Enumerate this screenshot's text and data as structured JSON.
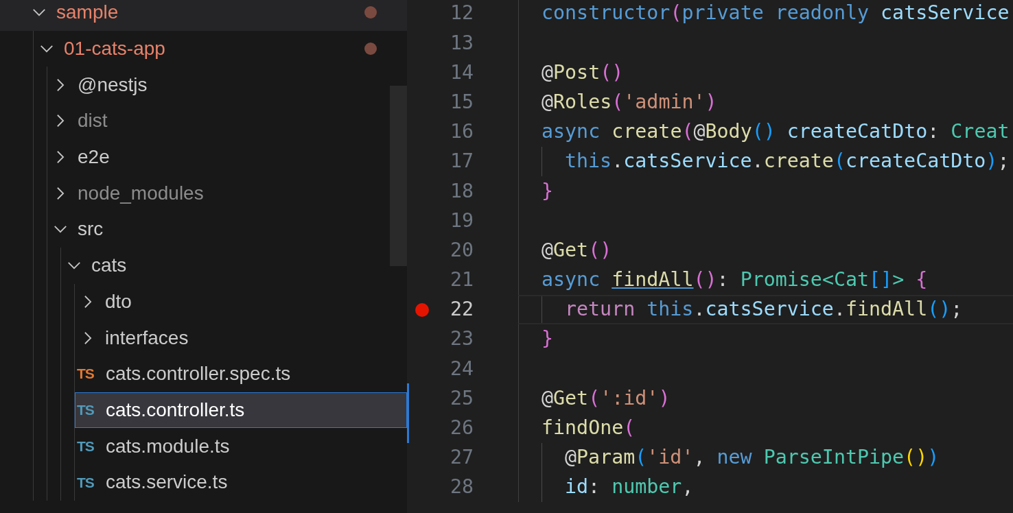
{
  "explorer": {
    "tree": [
      {
        "name": "sample",
        "kind": "folder",
        "expanded": true,
        "modified": true,
        "ignored": false,
        "selected": false,
        "children": [
          {
            "name": "01-cats-app",
            "kind": "folder",
            "expanded": true,
            "modified": true,
            "ignored": false,
            "selected": false,
            "children": [
              {
                "name": "@nestjs",
                "kind": "folder",
                "expanded": false,
                "modified": false,
                "ignored": false,
                "selected": false
              },
              {
                "name": "dist",
                "kind": "folder",
                "expanded": false,
                "modified": false,
                "ignored": true,
                "selected": false
              },
              {
                "name": "e2e",
                "kind": "folder",
                "expanded": false,
                "modified": false,
                "ignored": false,
                "selected": false
              },
              {
                "name": "node_modules",
                "kind": "folder",
                "expanded": false,
                "modified": false,
                "ignored": true,
                "selected": false
              },
              {
                "name": "src",
                "kind": "folder",
                "expanded": true,
                "modified": false,
                "ignored": false,
                "selected": false,
                "children": [
                  {
                    "name": "cats",
                    "kind": "folder",
                    "expanded": true,
                    "modified": false,
                    "ignored": false,
                    "selected": false,
                    "children": [
                      {
                        "name": "dto",
                        "kind": "folder",
                        "expanded": false,
                        "modified": false,
                        "ignored": false,
                        "selected": false
                      },
                      {
                        "name": "interfaces",
                        "kind": "folder",
                        "expanded": false,
                        "modified": false,
                        "ignored": false,
                        "selected": false
                      },
                      {
                        "name": "cats.controller.spec.ts",
                        "kind": "file",
                        "icon_text": "TS",
                        "color": "#e37933",
                        "modified": false,
                        "ignored": false,
                        "selected": false
                      },
                      {
                        "name": "cats.controller.ts",
                        "kind": "file",
                        "icon_text": "TS",
                        "color": "#519aba",
                        "modified": false,
                        "ignored": false,
                        "selected": true
                      },
                      {
                        "name": "cats.module.ts",
                        "kind": "file",
                        "icon_text": "TS",
                        "color": "#519aba",
                        "modified": false,
                        "ignored": false,
                        "selected": false
                      },
                      {
                        "name": "cats.service.ts",
                        "kind": "file",
                        "icon_text": "TS",
                        "color": "#519aba",
                        "modified": false,
                        "ignored": false,
                        "selected": false
                      }
                    ]
                  }
                ]
              }
            ]
          }
        ]
      }
    ]
  },
  "editor": {
    "lines": [
      {
        "number": "12",
        "breakpoint": false,
        "current": false,
        "modified": false,
        "indented": false,
        "tokens": [
          {
            "text": "constructor",
            "kind": "kw"
          },
          {
            "text": "(",
            "kind": "br1"
          },
          {
            "text": "private readonly ",
            "kind": "kw"
          },
          {
            "text": "catsService",
            "kind": "var"
          }
        ]
      },
      {
        "number": "13",
        "breakpoint": false,
        "current": false,
        "modified": false,
        "indented": false
      },
      {
        "number": "14",
        "breakpoint": false,
        "current": false,
        "modified": false,
        "indented": false,
        "tokens": [
          {
            "text": "@",
            "kind": "punct"
          },
          {
            "text": "Post",
            "kind": "fn"
          },
          {
            "text": "()",
            "kind": "br1"
          }
        ]
      },
      {
        "number": "15",
        "breakpoint": false,
        "current": false,
        "modified": false,
        "indented": false,
        "tokens": [
          {
            "text": "@",
            "kind": "punct"
          },
          {
            "text": "Roles",
            "kind": "fn"
          },
          {
            "text": "(",
            "kind": "br1"
          },
          {
            "text": "'admin'",
            "kind": "str"
          },
          {
            "text": ")",
            "kind": "br1"
          }
        ]
      },
      {
        "number": "16",
        "breakpoint": false,
        "current": false,
        "modified": false,
        "indented": false,
        "tokens": [
          {
            "text": "async ",
            "kind": "kw"
          },
          {
            "text": "create",
            "kind": "fn"
          },
          {
            "text": "(",
            "kind": "br1"
          },
          {
            "text": "@",
            "kind": "punct"
          },
          {
            "text": "Body",
            "kind": "fn"
          },
          {
            "text": "()",
            "kind": "br2"
          },
          {
            "text": " createCatDto",
            "kind": "var"
          },
          {
            "text": ": ",
            "kind": "punct"
          },
          {
            "text": "Creat",
            "kind": "type"
          }
        ]
      },
      {
        "number": "17",
        "breakpoint": false,
        "current": false,
        "modified": false,
        "indented": true,
        "tokens": [
          {
            "text": "this",
            "kind": "kw"
          },
          {
            "text": ".",
            "kind": "punct"
          },
          {
            "text": "catsService",
            "kind": "var"
          },
          {
            "text": ".",
            "kind": "punct"
          },
          {
            "text": "create",
            "kind": "fn"
          },
          {
            "text": "(",
            "kind": "br2"
          },
          {
            "text": "createCatDto",
            "kind": "var"
          },
          {
            "text": ")",
            "kind": "br2"
          },
          {
            "text": ";",
            "kind": "punct"
          }
        ]
      },
      {
        "number": "18",
        "breakpoint": false,
        "current": false,
        "modified": false,
        "indented": false,
        "tokens": [
          {
            "text": "}",
            "kind": "br1"
          }
        ]
      },
      {
        "number": "19",
        "breakpoint": false,
        "current": false,
        "modified": false,
        "indented": false
      },
      {
        "number": "20",
        "breakpoint": false,
        "current": false,
        "modified": false,
        "indented": false,
        "tokens": [
          {
            "text": "@",
            "kind": "punct"
          },
          {
            "text": "Get",
            "kind": "fn"
          },
          {
            "text": "()",
            "kind": "br1"
          }
        ]
      },
      {
        "number": "21",
        "breakpoint": false,
        "current": false,
        "modified": false,
        "indented": false,
        "tokens": [
          {
            "text": "async ",
            "kind": "kw"
          },
          {
            "text": "findAll",
            "kind": "link"
          },
          {
            "text": "()",
            "kind": "br1"
          },
          {
            "text": ": ",
            "kind": "punct"
          },
          {
            "text": "Promise",
            "kind": "type"
          },
          {
            "text": "<",
            "kind": "type"
          },
          {
            "text": "Cat",
            "kind": "type"
          },
          {
            "text": "[]",
            "kind": "br2"
          },
          {
            "text": "> ",
            "kind": "type"
          },
          {
            "text": "{",
            "kind": "br1"
          }
        ]
      },
      {
        "number": "22",
        "breakpoint": true,
        "current": true,
        "modified": false,
        "indented": true,
        "tokens": [
          {
            "text": "return ",
            "kind": "ctrl"
          },
          {
            "text": "this",
            "kind": "kw"
          },
          {
            "text": ".",
            "kind": "punct"
          },
          {
            "text": "catsService",
            "kind": "var"
          },
          {
            "text": ".",
            "kind": "punct"
          },
          {
            "text": "findAll",
            "kind": "fn"
          },
          {
            "text": "()",
            "kind": "br2"
          },
          {
            "text": ";",
            "kind": "punct"
          }
        ]
      },
      {
        "number": "23",
        "breakpoint": false,
        "current": false,
        "modified": false,
        "indented": false,
        "tokens": [
          {
            "text": "}",
            "kind": "br1"
          }
        ]
      },
      {
        "number": "24",
        "breakpoint": false,
        "current": false,
        "modified": false,
        "indented": false
      },
      {
        "number": "25",
        "breakpoint": false,
        "current": false,
        "modified": true,
        "indented": false,
        "tokens": [
          {
            "text": "@",
            "kind": "punct"
          },
          {
            "text": "Get",
            "kind": "fn"
          },
          {
            "text": "(",
            "kind": "br1"
          },
          {
            "text": "':id'",
            "kind": "str"
          },
          {
            "text": ")",
            "kind": "br1"
          }
        ]
      },
      {
        "number": "26",
        "breakpoint": false,
        "current": false,
        "modified": true,
        "indented": false,
        "tokens": [
          {
            "text": "findOne",
            "kind": "fn"
          },
          {
            "text": "(",
            "kind": "br1"
          }
        ]
      },
      {
        "number": "27",
        "breakpoint": false,
        "current": false,
        "modified": false,
        "indented": true,
        "tokens": [
          {
            "text": "@",
            "kind": "punct"
          },
          {
            "text": "Param",
            "kind": "fn"
          },
          {
            "text": "(",
            "kind": "br2"
          },
          {
            "text": "'id'",
            "kind": "str"
          },
          {
            "text": ", ",
            "kind": "punct"
          },
          {
            "text": "new ",
            "kind": "kw"
          },
          {
            "text": "ParseIntPipe",
            "kind": "type"
          },
          {
            "text": "()",
            "kind": "br3"
          },
          {
            "text": ")",
            "kind": "br2"
          }
        ]
      },
      {
        "number": "28",
        "breakpoint": false,
        "current": false,
        "modified": false,
        "indented": true,
        "tokens": [
          {
            "text": "id",
            "kind": "var"
          },
          {
            "text": ": ",
            "kind": "punct"
          },
          {
            "text": "number",
            "kind": "type"
          },
          {
            "text": ",",
            "kind": "punct"
          }
        ]
      }
    ]
  }
}
